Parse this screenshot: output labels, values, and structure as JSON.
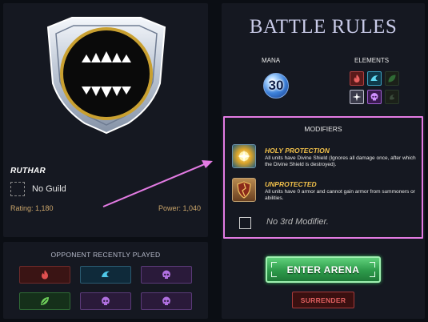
{
  "player": {
    "name": "RUTHAR",
    "guild": "No Guild",
    "rating": "Rating: 1,180",
    "power": "Power: 1,040",
    "emblem_icon": "fanged-mouth-emblem-icon"
  },
  "recent": {
    "title": "OPPONENT RECENTLY PLAYED",
    "items": [
      {
        "element": "fire",
        "icon": "fire-icon"
      },
      {
        "element": "water",
        "icon": "water-wave-icon"
      },
      {
        "element": "death",
        "icon": "skull-icon"
      },
      {
        "element": "earth",
        "icon": "leaf-icon"
      },
      {
        "element": "death",
        "icon": "skull-icon"
      },
      {
        "element": "death",
        "icon": "skull-icon"
      }
    ]
  },
  "rules": {
    "title": "BATTLE RULES",
    "mana_label": "MANA",
    "mana_value": "30",
    "elements_label": "ELEMENTS",
    "elements": [
      {
        "name": "fire",
        "active": true,
        "icon": "fire-icon",
        "color": "#d84040"
      },
      {
        "name": "water",
        "active": true,
        "icon": "water-wave-icon",
        "color": "#40c0e0"
      },
      {
        "name": "earth",
        "active": false,
        "icon": "leaf-icon",
        "color": "#2f6a35"
      },
      {
        "name": "life",
        "active": true,
        "icon": "star-icon",
        "color": "#ffffff"
      },
      {
        "name": "death",
        "active": true,
        "icon": "skull-icon",
        "color": "#b070e0"
      },
      {
        "name": "dragon",
        "active": false,
        "icon": "dragon-icon",
        "color": "#3a4a3a"
      }
    ]
  },
  "modifiers": {
    "header": "MODIFIERS",
    "items": [
      {
        "title": "HOLY PROTECTION",
        "description": "All units have Divine Shield (Ignores all damage once, after which the Divine Shield is destroyed).",
        "icon": "holy-protection-icon"
      },
      {
        "title": "UNPROTECTED",
        "description": "All units have 0 armor and cannot gain armor from summoners or abilities.",
        "icon": "broken-shield-icon"
      }
    ],
    "empty_label": "No 3rd Modifier."
  },
  "actions": {
    "enter_label": "ENTER ARENA",
    "surrender_label": "SURRENDER"
  },
  "colors": {
    "panel_bg": "#151821",
    "page_bg": "#0b0e14",
    "highlight": "#e37be3",
    "gold": "#f2c14a",
    "accent_green": "#2d9a4a",
    "danger_red": "#a83a3a"
  }
}
